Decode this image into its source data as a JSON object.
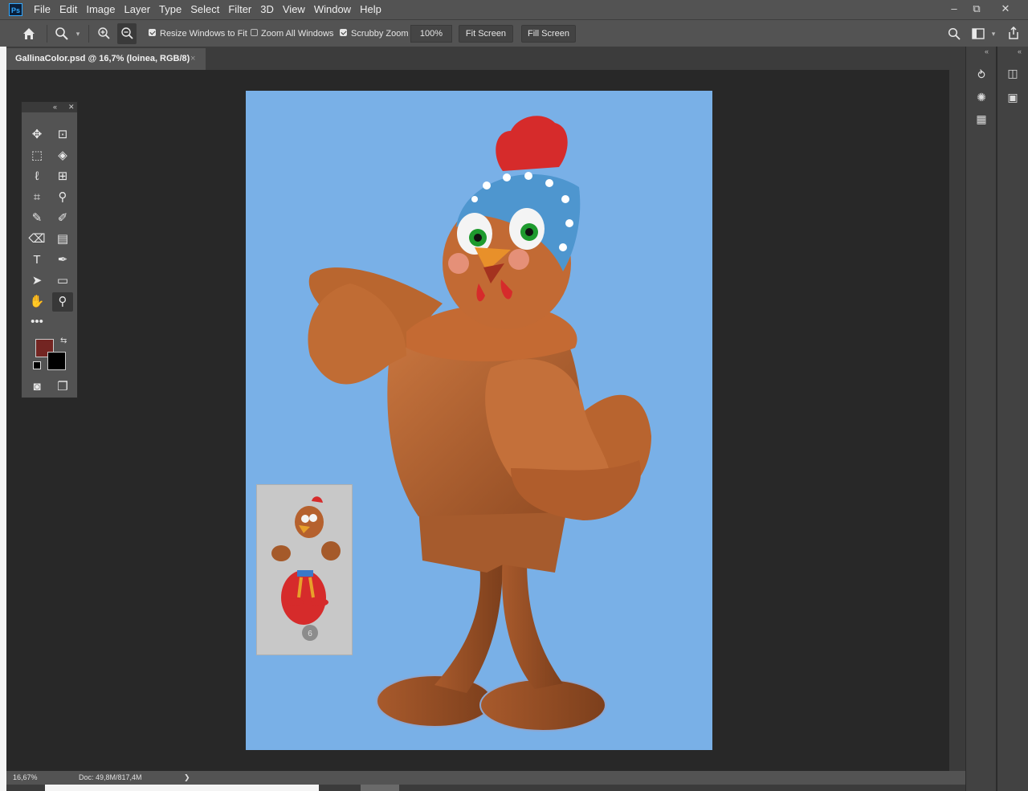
{
  "menubar": {
    "app_icon": "Ps",
    "items": [
      "File",
      "Edit",
      "Image",
      "Layer",
      "Type",
      "Select",
      "Filter",
      "3D",
      "View",
      "Window",
      "Help"
    ],
    "window_controls": {
      "minimize": "–",
      "restore": "⧉",
      "close": "✕"
    }
  },
  "options": {
    "home_icon": "home-icon",
    "tool_icon": "zoom-tool-icon",
    "resize_windows": {
      "label": "Resize Windows to Fit",
      "checked": true
    },
    "zoom_all": {
      "label": "Zoom All Windows",
      "checked": false
    },
    "scrubby": {
      "label": "Scrubby Zoom",
      "checked": true
    },
    "zoom_value": "100%",
    "fit_screen": "Fit Screen",
    "fill_screen": "Fill Screen"
  },
  "document": {
    "tab_label": "GallinaColor.psd @ 16,7% (loinea, RGB/8)",
    "close": "×"
  },
  "statusbar": {
    "zoom": "16,67%",
    "doc": "Doc: 49,8M/817,4M",
    "arrow": "❯"
  },
  "colors": {
    "foreground": "#732522",
    "background": "#000000",
    "canvas": "#79b0e7"
  },
  "navigator_badge": "6"
}
